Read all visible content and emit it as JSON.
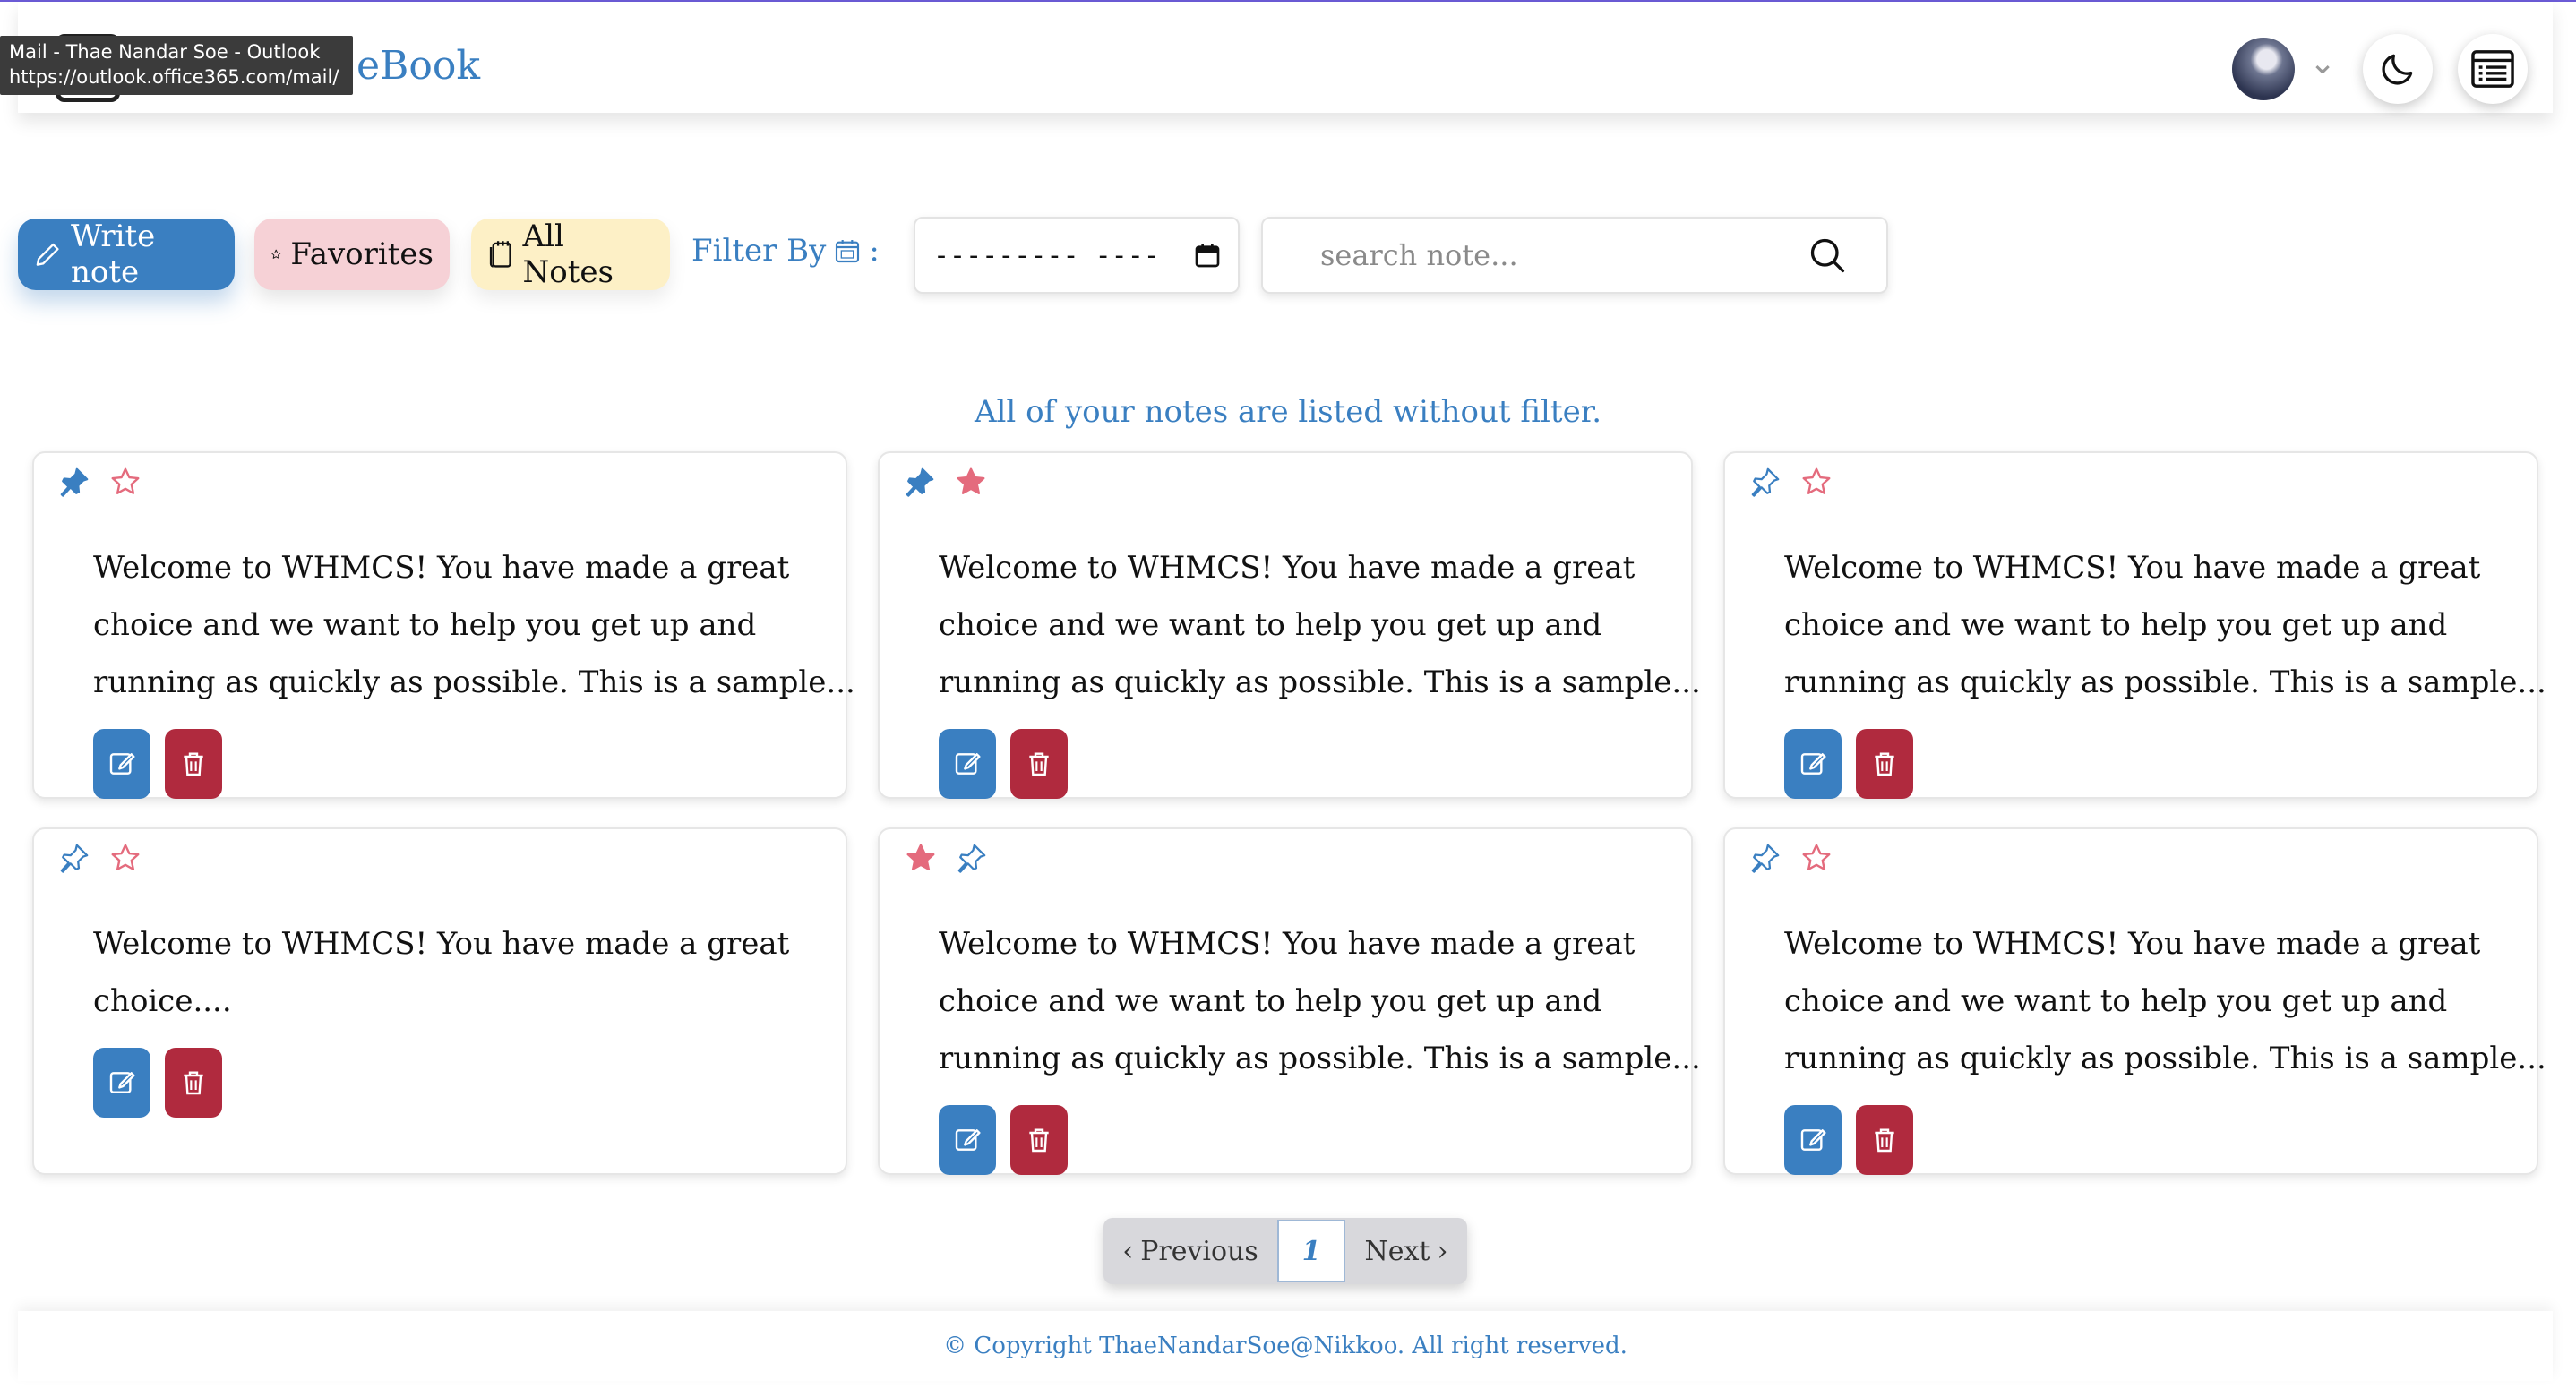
{
  "browser_tooltip": {
    "title": "Mail - Thae Nandar Soe - Outlook",
    "url": "https://outlook.office365.com/mail/"
  },
  "header": {
    "brand_visible": "eBook",
    "icons": [
      "notebook-icon",
      "avatar",
      "chevron-down-icon",
      "moon-icon",
      "list-icon"
    ]
  },
  "toolbar": {
    "write_label": "Write note",
    "favorites_label": "Favorites",
    "all_notes_label": "All Notes",
    "filter_label": "Filter By",
    "filter_colon": ":",
    "date_value": "--------- ----",
    "search_placeholder": "search note..."
  },
  "status_text": "All of your notes are listed without filter.",
  "notes": [
    {
      "pinned": true,
      "favorite": false,
      "lines": [
        "Welcome to WHMCS! You have made a great",
        "choice and we want to help you get up and",
        "running as quickly as possible. This is a sample..."
      ]
    },
    {
      "pinned": true,
      "favorite": true,
      "lines": [
        "Welcome to WHMCS! You have made a great",
        "choice and we want to help you get up and",
        "running as quickly as possible. This is a sample..."
      ]
    },
    {
      "pinned": false,
      "favorite": false,
      "lines": [
        "Welcome to WHMCS! You have made a great",
        "choice and we want to help you get up and",
        "running as quickly as possible. This is a sample..."
      ]
    },
    {
      "pinned": false,
      "favorite": false,
      "lines": [
        "Welcome to WHMCS! You have made a great",
        "choice...."
      ]
    },
    {
      "pinned": false,
      "favorite": true,
      "lines": [
        "Welcome to WHMCS! You have made a great",
        "choice and we want to help you get up and",
        "running as quickly as possible. This is a sample..."
      ]
    },
    {
      "pinned": false,
      "favorite": false,
      "lines": [
        "Welcome to WHMCS! You have made a great",
        "choice and we want to help you get up and",
        "running as quickly as possible. This is a sample..."
      ]
    }
  ],
  "pagination": {
    "prev_label": "Previous",
    "current_page": "1",
    "next_label": "Next"
  },
  "footer": {
    "copyright": "© Copyright ThaeNandarSoe@Nikkoo. All right reserved."
  },
  "colors": {
    "accent": "#3a7fc1",
    "danger": "#b02a3e",
    "favorite": "#e46b7d",
    "favorites_bg": "#f6d1d6",
    "all_notes_bg": "#fdf0c6"
  }
}
